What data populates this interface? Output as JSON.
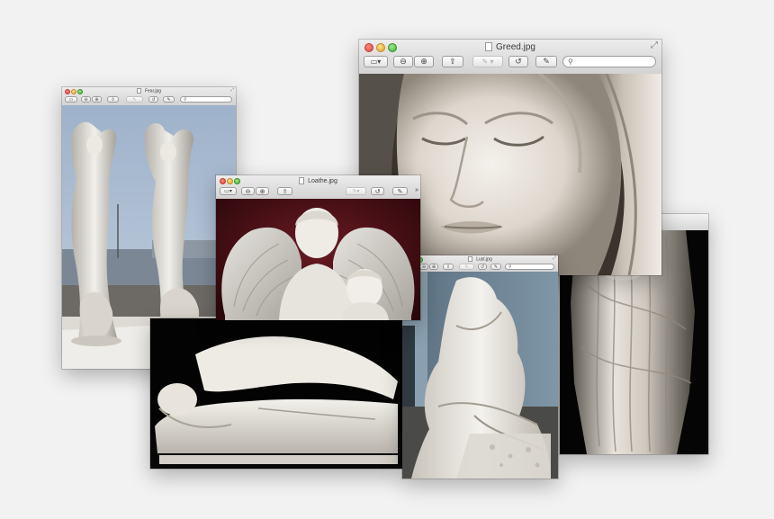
{
  "windows": {
    "fear": {
      "title": "Fear.jpg",
      "image": "marble statues of two dancing women with cherubs"
    },
    "greed": {
      "title": "Greed.jpg",
      "image": "marble face of veiled woman with closed eyes"
    },
    "loathe": {
      "title": "Loathe.jpg",
      "image": "marble angel with wings and small cherub"
    },
    "lust": {
      "title": "Lust.jpg",
      "image": "marble sculpture of embracing couple"
    },
    "sleep": {
      "title": "",
      "image": "marble sculpture of reclining sleeping woman"
    },
    "draped": {
      "title": "",
      "image": "marble draped female figure"
    }
  },
  "toolbar": {
    "icons": [
      "sidebar-icon",
      "zoom-out-icon",
      "zoom-in-icon",
      "share-icon",
      "pen-icon",
      "rotate-icon",
      "edit-icon",
      "search-icon"
    ]
  },
  "colors": {
    "desktop": "#f2f2f2",
    "titlebar": "#dcdcdc"
  }
}
